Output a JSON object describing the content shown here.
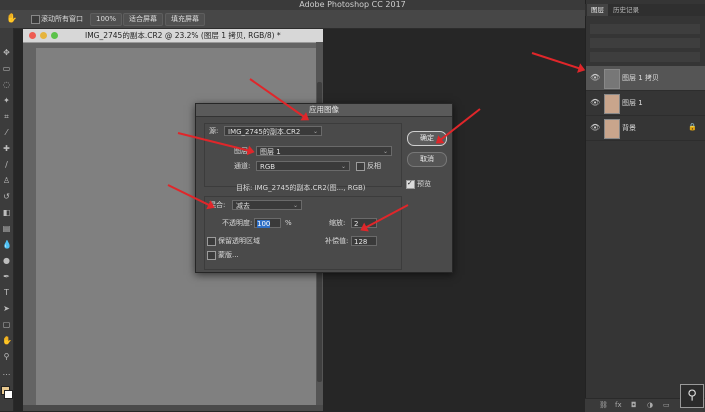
{
  "app": {
    "title": "Adobe Photoshop CC 2017"
  },
  "options_bar": {
    "scroll_all_label": "滚动所有窗口",
    "zoom_100_label": "100%",
    "fit_screen_label": "适合屏幕",
    "fill_screen_label": "填充屏幕"
  },
  "document": {
    "tab_title": "IMG_2745的副本.CR2 @ 23.2% (图层 1 拷贝, RGB/8) *"
  },
  "panel": {
    "tabs": [
      "图层",
      "历史记录"
    ],
    "layers": [
      {
        "name": "图层 1 拷贝",
        "selected": true,
        "thumb": "gray"
      },
      {
        "name": "图层 1",
        "selected": false,
        "thumb": "photo"
      },
      {
        "name": "背景",
        "selected": false,
        "thumb": "photo",
        "locked": true
      }
    ]
  },
  "dialog": {
    "title": "应用图像",
    "source_label": "源:",
    "source_value": "IMG_2745的副本.CR2",
    "layer_label": "图层:",
    "layer_value": "图层 1",
    "channel_label": "通道:",
    "channel_value": "RGB",
    "invert_label": "反相",
    "target_text": "目标: IMG_2745的副本.CR2(图..., RGB)",
    "blending_label": "混合:",
    "blending_value": "减去",
    "opacity_label": "不透明度:",
    "opacity_value": "100",
    "opacity_unit": "%",
    "scale_label": "缩放:",
    "scale_value": "2",
    "preserve_label": "保留透明区域",
    "offset_label": "补偿值:",
    "offset_value": "128",
    "mask_label": "蒙版...",
    "ok_label": "确定",
    "cancel_label": "取消",
    "preview_label": "预览",
    "preview_checked": true
  },
  "colors": {
    "annotation_arrow": "#e0262a",
    "ui_dark": "#262626"
  }
}
